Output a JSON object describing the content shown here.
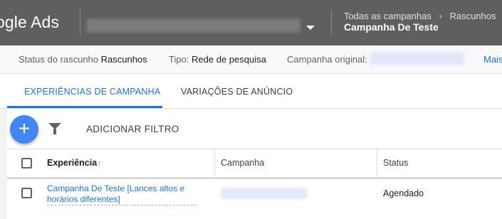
{
  "header": {
    "logo_text": "ogle Ads",
    "breadcrumb": [
      "Todas as campanhas",
      "Rascunhos"
    ],
    "breadcrumb_separator": "›",
    "campaign_title": "Campanha De Teste"
  },
  "infobar": {
    "draft_status_label": "Status do rascunho",
    "draft_status_value": "Rascunhos",
    "type_label": "Tipo:",
    "type_value": "Rede de pesquisa",
    "original_label": "Campanha original:",
    "more_link": "Mais"
  },
  "tabs": [
    {
      "label": "EXPERIÊNCIAS DE CAMPANHA",
      "active": true
    },
    {
      "label": "VARIAÇÕES DE ANÚNCIO",
      "active": false
    }
  ],
  "toolbar": {
    "add_button_symbol": "+",
    "add_filter_label": "ADICIONAR FILTRO"
  },
  "table": {
    "columns": [
      "Experiência",
      "Campanha",
      "Status"
    ],
    "sort_indicator": "↑",
    "rows": [
      {
        "experience": "Campanha De Teste [Lances altos e horários diferentes]",
        "status": "Agendado"
      }
    ]
  },
  "colors": {
    "header_bg": "#5f5f5f",
    "accent": "#1a73e8",
    "fab": "#4285f4"
  },
  "icons": [
    "dropdown-arrow-icon",
    "chevron-right-icon",
    "add-icon",
    "filter-icon",
    "sort-ascending-icon",
    "checkbox-icon"
  ]
}
